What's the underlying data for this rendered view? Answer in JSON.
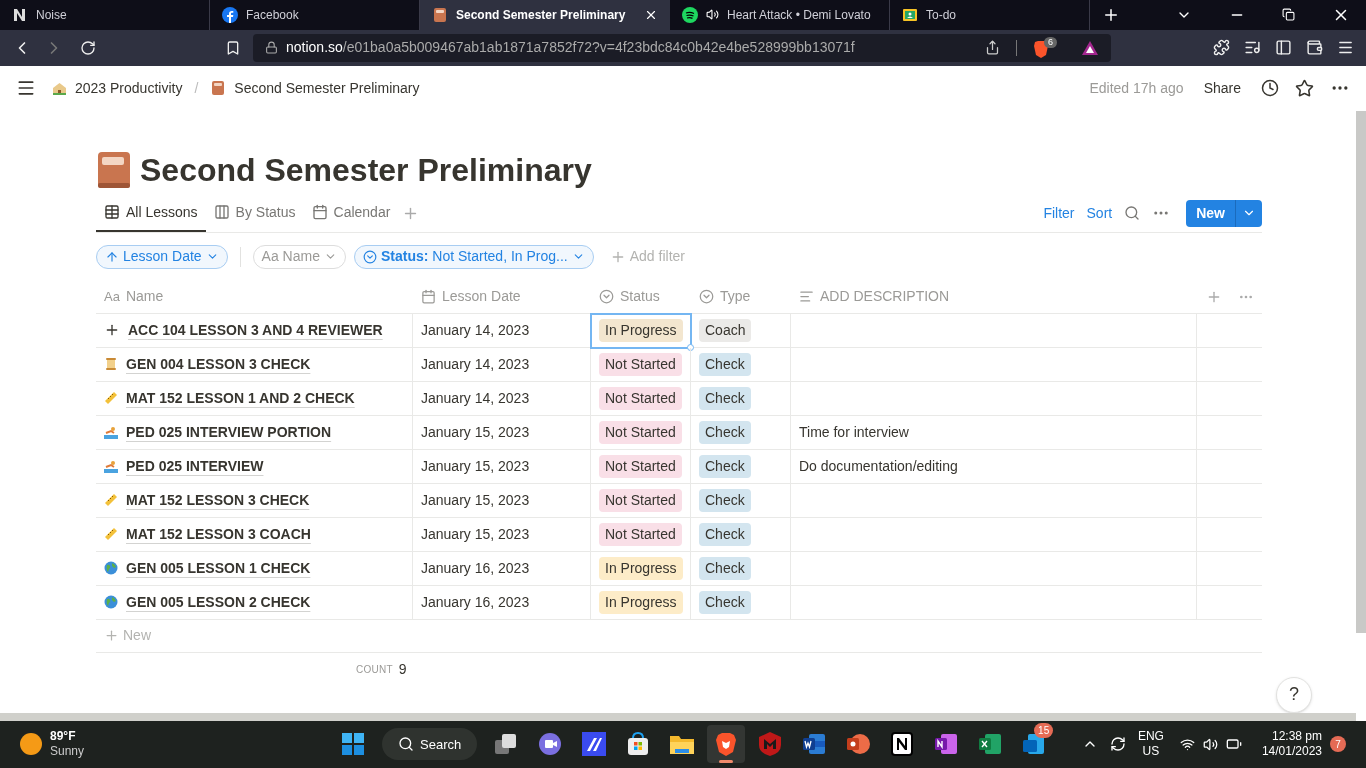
{
  "browser_tabs": [
    {
      "title": "Noise",
      "kind": "noise",
      "selected": false,
      "audio": false
    },
    {
      "title": "Facebook",
      "kind": "facebook",
      "selected": false,
      "audio": false
    },
    {
      "title": "Second Semester Preliminary",
      "kind": "book",
      "selected": true,
      "audio": false
    },
    {
      "title": "Heart Attack • Demi Lovato",
      "kind": "spotify",
      "selected": false,
      "audio": true
    },
    {
      "title": "To-do",
      "kind": "classroom",
      "selected": false,
      "audio": false
    }
  ],
  "address": {
    "host": "notion.so",
    "path": "/e01ba0a5b009467ab1ab1871a7852f72?v=4f23bdc84c0b42e4be528999bb13071f",
    "shield_count": "6"
  },
  "breadcrumbs": [
    {
      "label": "2023 Productivity",
      "kind": "house"
    },
    {
      "label": "Second Semester Preliminary",
      "kind": "book",
      "separator": "/"
    }
  ],
  "topbar": {
    "edited": "Edited 17h ago",
    "share": "Share"
  },
  "page_title": "Second Semester Preliminary",
  "views": [
    {
      "label": "All Lessons",
      "kind": "table",
      "selected": true
    },
    {
      "label": "By Status",
      "kind": "board",
      "selected": false
    },
    {
      "label": "Calendar",
      "kind": "calendar",
      "selected": false
    }
  ],
  "toolbar": {
    "filter": "Filter",
    "sort": "Sort",
    "new": "New"
  },
  "filters": {
    "sort": "Lesson Date",
    "name": "Aa Name",
    "status_key": "Status:",
    "status_value": " Not Started, In Prog...",
    "add": "Add filter"
  },
  "columns": [
    {
      "label": "Name",
      "kind": "text",
      "prefix": "Aa"
    },
    {
      "label": "Lesson Date",
      "kind": "date"
    },
    {
      "label": "Status",
      "kind": "select"
    },
    {
      "label": "Type",
      "kind": "select"
    },
    {
      "label": "ADD DESCRIPTION",
      "kind": "lines"
    }
  ],
  "rows": [
    {
      "name": "ACC 104 LESSON 3 AND 4 REVIEWER",
      "kind": "plus",
      "date": "January 14, 2023",
      "status": {
        "text": "In Progress",
        "color": "#f3e6cf",
        "selected": true
      },
      "type": {
        "text": "Coach",
        "color": "#ebeae8"
      }
    },
    {
      "name": "GEN 004 LESSON 3 CHECK",
      "kind": "scroll",
      "date": "January 14, 2023",
      "status": {
        "text": "Not Started",
        "color": "#f9dfe7",
        "selected": false
      },
      "type": {
        "text": "Check",
        "color": "#d3e5ef"
      }
    },
    {
      "name": "MAT 152 LESSON 1 AND 2 CHECK",
      "kind": "ruler",
      "date": "January 14, 2023",
      "status": {
        "text": "Not Started",
        "color": "#f9dfe7",
        "selected": false
      },
      "type": {
        "text": "Check",
        "color": "#d3e5ef"
      }
    },
    {
      "name": "PED 025 INTERVIEW PORTION",
      "kind": "swim",
      "date": "January 15, 2023",
      "status": {
        "text": "Not Started",
        "color": "#f9dfe7",
        "selected": false
      },
      "type": {
        "text": "Check",
        "color": "#d3e5ef"
      },
      "description": "Time for interview"
    },
    {
      "name": "PED 025 INTERVIEW",
      "kind": "swim",
      "date": "January 15, 2023",
      "status": {
        "text": "Not Started",
        "color": "#f9dfe7",
        "selected": false
      },
      "type": {
        "text": "Check",
        "color": "#d3e5ef"
      },
      "description": "Do documentation/editing"
    },
    {
      "name": "MAT 152 LESSON 3 CHECK",
      "kind": "ruler",
      "date": "January 15, 2023",
      "status": {
        "text": "Not Started",
        "color": "#f9dfe7",
        "selected": false
      },
      "type": {
        "text": "Check",
        "color": "#d3e5ef"
      }
    },
    {
      "name": "MAT 152 LESSON 3 COACH",
      "kind": "ruler",
      "date": "January 15, 2023",
      "status": {
        "text": "Not Started",
        "color": "#f9dfe7",
        "selected": false
      },
      "type": {
        "text": "Check",
        "color": "#d3e5ef"
      }
    },
    {
      "name": "GEN 005 LESSON 1 CHECK",
      "kind": "globe",
      "date": "January 16, 2023",
      "status": {
        "text": "In Progress",
        "color": "#fdecc8",
        "selected": false
      },
      "type": {
        "text": "Check",
        "color": "#d3e5ef"
      }
    },
    {
      "name": "GEN 005 LESSON 2 CHECK",
      "kind": "globe",
      "date": "January 16, 2023",
      "status": {
        "text": "In Progress",
        "color": "#fdecc8",
        "selected": false
      },
      "type": {
        "text": "Check",
        "color": "#d3e5ef"
      }
    }
  ],
  "new_row": "New",
  "count": {
    "label": "COUNT",
    "value": "9"
  },
  "help": "?",
  "taskbar": {
    "temp": "89°F",
    "weather": "Sunny",
    "search": "Search",
    "apps": [
      {
        "kind": "windows"
      },
      {
        "kind": "taskview"
      },
      {
        "kind": "meet"
      },
      {
        "kind": "ai"
      },
      {
        "kind": "store"
      },
      {
        "kind": "folder"
      },
      {
        "kind": "brave",
        "selected": true
      },
      {
        "kind": "shield",
        "selected": false
      },
      {
        "kind": "word",
        "selected": false
      },
      {
        "kind": "ppt",
        "selected": false
      },
      {
        "kind": "notion",
        "selected": false
      },
      {
        "kind": "onenote",
        "selected": false
      },
      {
        "kind": "excel",
        "selected": false
      },
      {
        "kind": "outlook",
        "selected": false,
        "badge": "15"
      }
    ],
    "lang": "ENG",
    "region": "US",
    "time": "12:38 pm",
    "date": "14/01/2023",
    "notifications": "7"
  }
}
